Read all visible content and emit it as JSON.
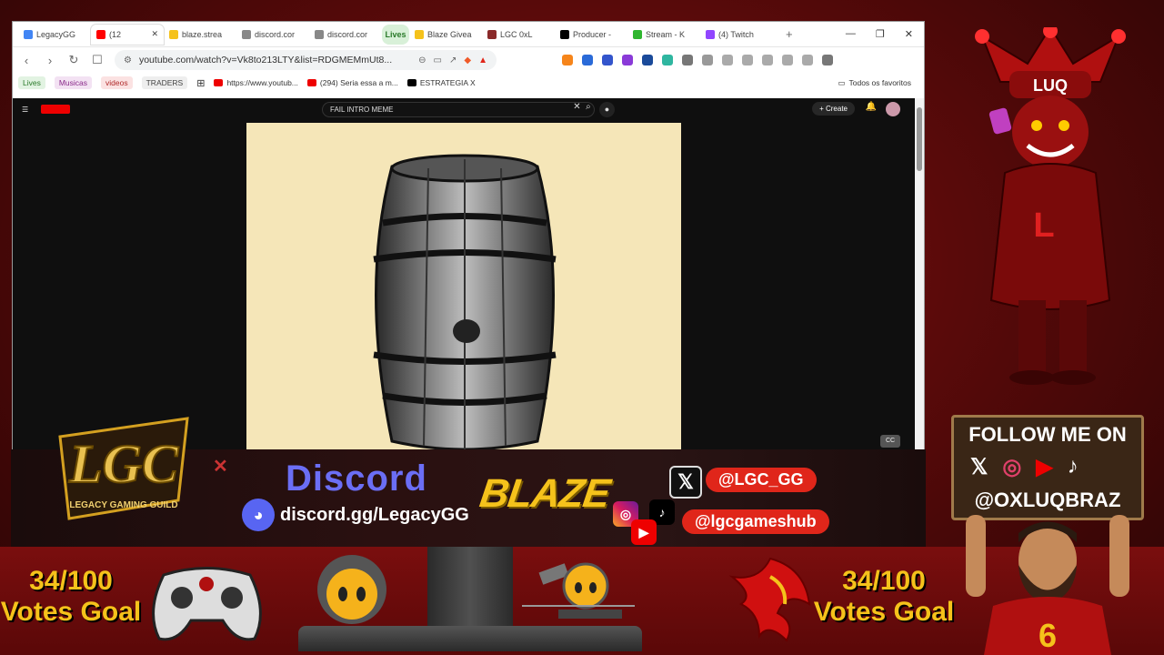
{
  "browser": {
    "tabs": [
      {
        "label": "LegacyGG",
        "color": "#4285f4",
        "active": false
      },
      {
        "label": "(12",
        "color": "#ff0000",
        "active": true
      },
      {
        "label": "blaze.strea",
        "color": "#f5c21b",
        "active": false
      },
      {
        "label": "discord.cor",
        "color": "#888888",
        "active": false
      },
      {
        "label": "discord.cor",
        "color": "#888888",
        "active": false
      },
      {
        "label": "Lives",
        "color": "#2a7a2a",
        "group": true
      },
      {
        "label": "Blaze Givea",
        "color": "#f5c21b",
        "active": false
      },
      {
        "label": "LGC 0xL",
        "color": "#8a2a2a",
        "active": false
      },
      {
        "label": "Producer -",
        "color": "#000000",
        "active": false
      },
      {
        "label": "Stream - K",
        "color": "#2fb62f",
        "active": false
      },
      {
        "label": "(4) Twitch",
        "color": "#9146ff",
        "active": false
      }
    ],
    "new_tab": "+",
    "window_controls": {
      "minimize": "—",
      "restore": "❐",
      "close": "✕"
    },
    "url": "youtube.com/watch?v=Vk8to213LTY&list=RDGMEMmUt8...",
    "bookmarks": {
      "chips": [
        {
          "label": "Lives",
          "bg": "#e2f3e2",
          "fg": "#2a7a2a"
        },
        {
          "label": "Musicas",
          "bg": "#f3e2f3",
          "fg": "#8a2a8a"
        },
        {
          "label": "videos",
          "bg": "#fbe2e2",
          "fg": "#b02a2a"
        },
        {
          "label": "TRADERS",
          "bg": "#eeeeee",
          "fg": "#444444"
        }
      ],
      "items": [
        {
          "label": "https://www.youtub..."
        },
        {
          "label": "(294) Seria essa a m..."
        },
        {
          "label": "ESTRATEGIA X"
        }
      ],
      "all_bookmarks": "Todos os favoritos"
    },
    "youtube": {
      "search_query": "FAIL INTRO MEME",
      "create_label": "Create",
      "cc_label": "CC"
    }
  },
  "overlay": {
    "brand_close": "✕",
    "discord": {
      "title": "Discord",
      "link": "discord.gg/LegacyGG"
    },
    "blaze": "BLAZE",
    "social": {
      "x_handle": "@LGC_GG",
      "ig_handle": "@lgcgameshub"
    },
    "left_goal": {
      "count": "34/100",
      "label": "Votes Goal"
    },
    "right_goal": {
      "count": "34/100",
      "label": "Votes Goal"
    },
    "follow_card": {
      "title": "FOLLOW ME ON",
      "handle": "@OXLUQBRAZ"
    },
    "mascot_cap": "LUQ",
    "jersey_number": "6",
    "logo_text": "LGC",
    "logo_subtitle": "LEGACY GAMING GUILD"
  }
}
